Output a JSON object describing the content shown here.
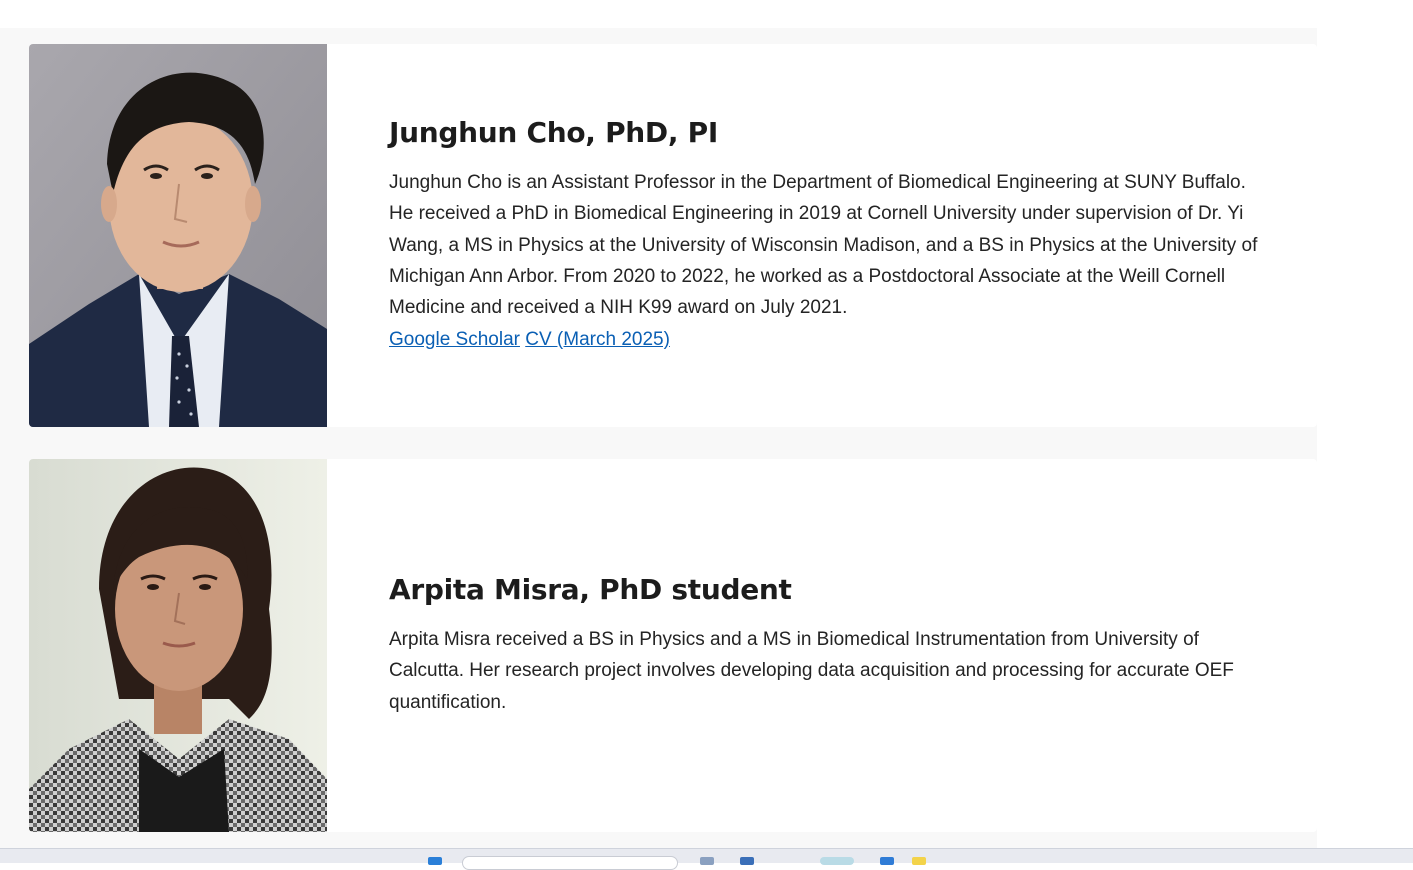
{
  "people": [
    {
      "name": "Junghun Cho, PhD, PI",
      "bio": "Junghun Cho is an Assistant Professor in the Department of Biomedical Engineering at SUNY Buffalo. He received a PhD in Biomedical Engineering in 2019 at Cornell University under supervision of Dr. Yi Wang, a MS in Physics at the University of Wisconsin Madison, and a BS in Physics at the University of Michigan Ann Arbor. From 2020 to 2022, he worked as a Postdoctoral Associate at the Weill Cornell Medicine and received a NIH K99 award on July 2021.",
      "links": [
        "Google Scholar",
        "CV (March 2025)"
      ]
    },
    {
      "name": "Arpita Misra, PhD student",
      "bio": "Arpita Misra received a BS in Physics and a MS in Biomedical Instrumentation from University of Calcutta. Her research project involves developing data acquisition and processing for accurate OEF quantification."
    }
  ],
  "colors": {
    "page_bg": "#f8f8f8",
    "card_bg": "#ffffff",
    "link": "#0a5fb4",
    "text": "#242424"
  }
}
